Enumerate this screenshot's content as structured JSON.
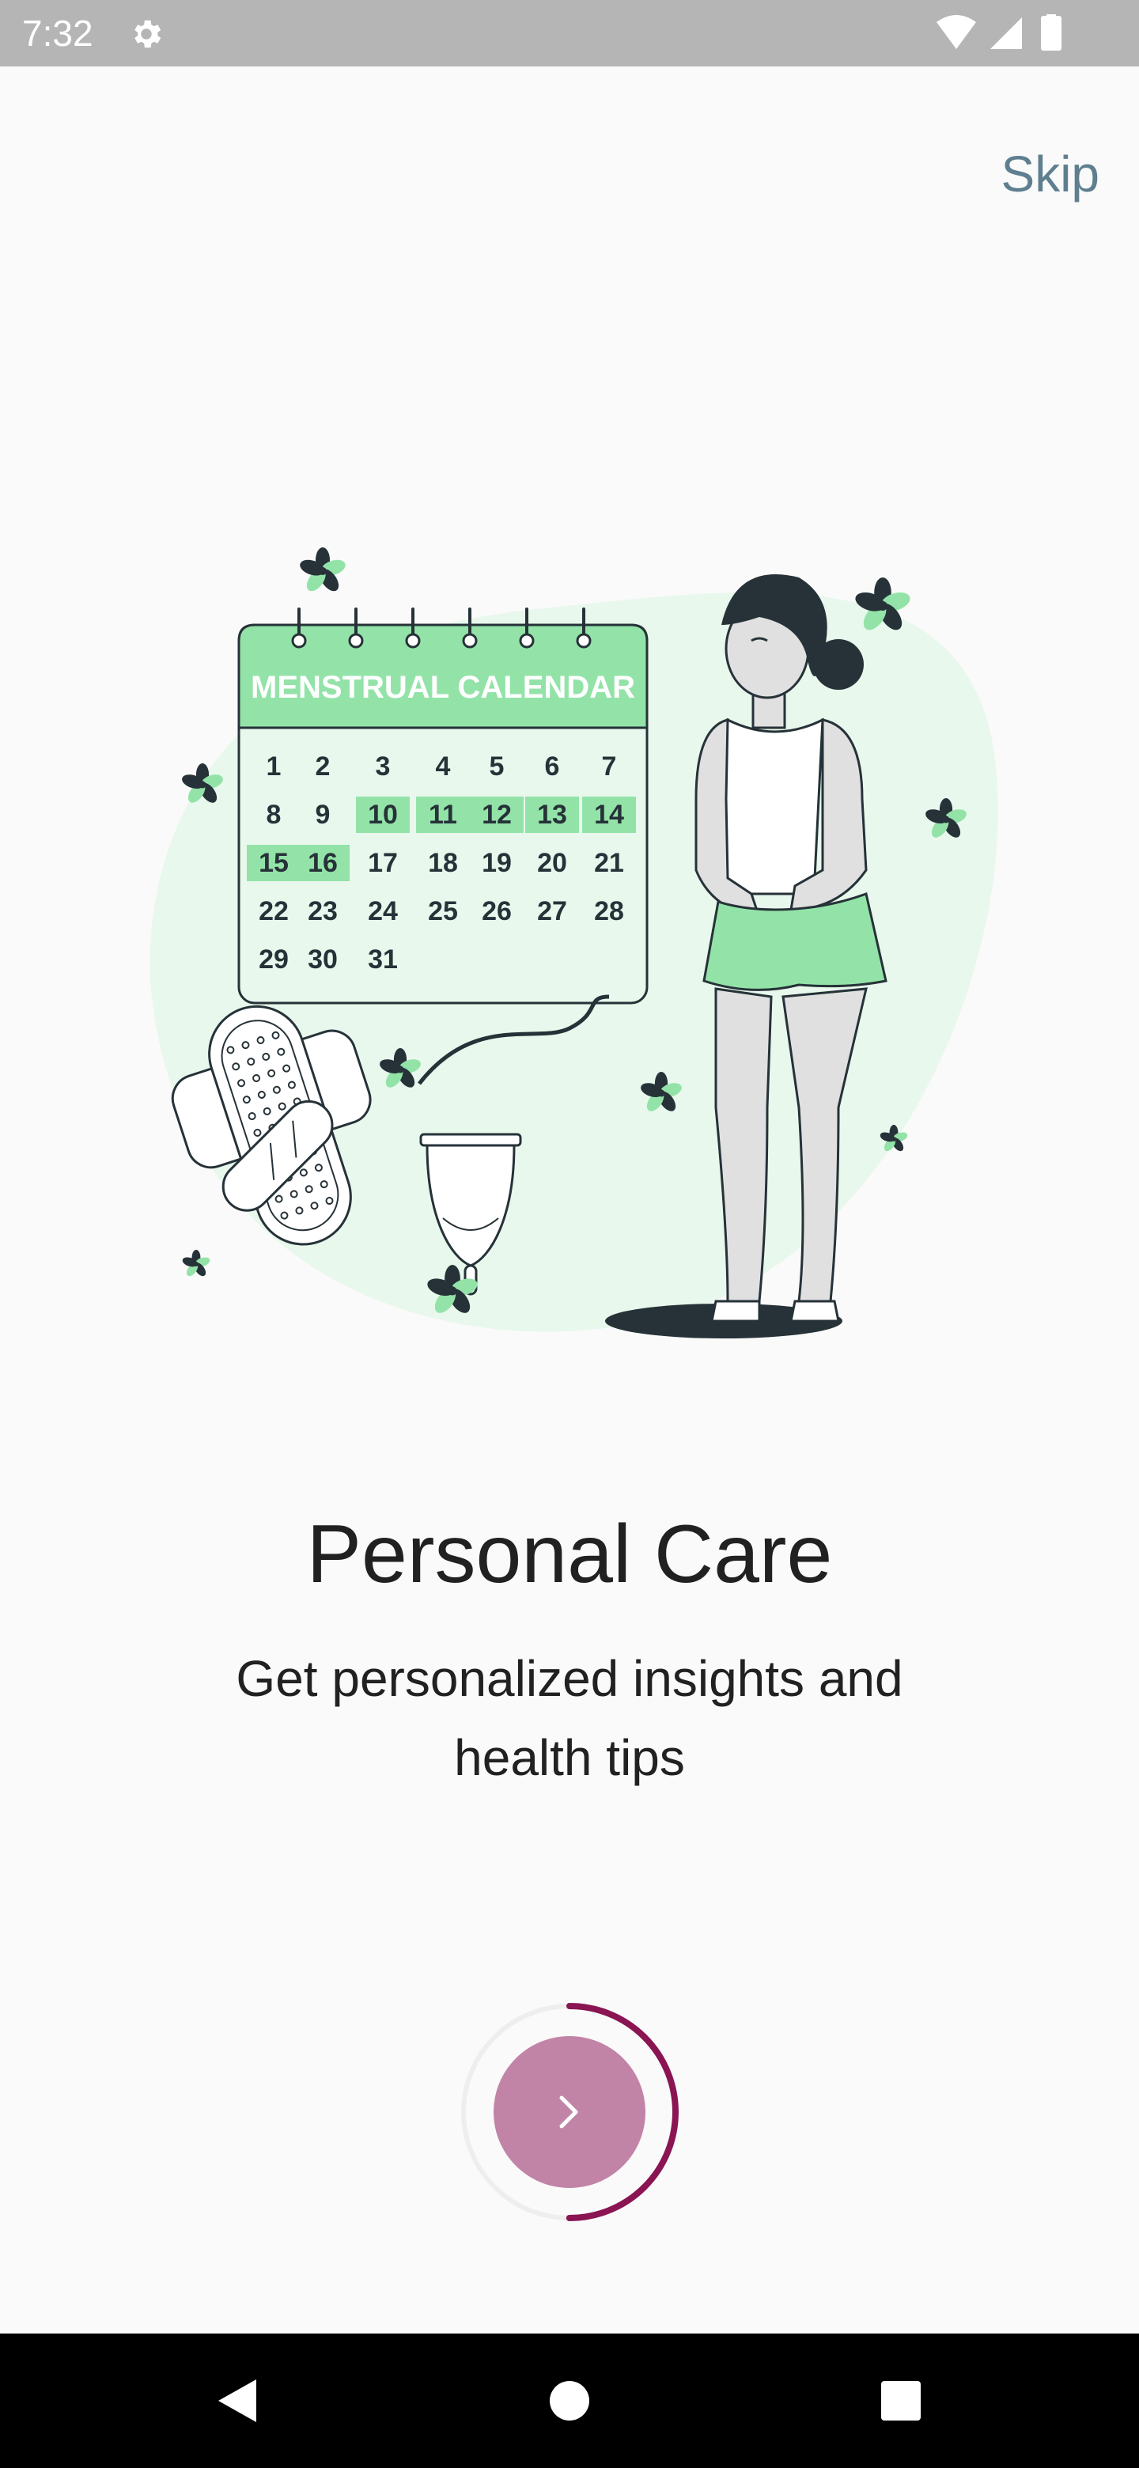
{
  "status_bar": {
    "time": "7:32",
    "left_icon": "gear-icon",
    "right_icons": [
      "wifi-icon",
      "signal-icon",
      "battery-icon"
    ]
  },
  "header": {
    "skip_label": "Skip"
  },
  "illustration": {
    "calendar_title": "MENSTRUAL CALENDAR",
    "calendar_days": [
      [
        "1",
        "2",
        "3",
        "4",
        "5",
        "6",
        "7"
      ],
      [
        "8",
        "9",
        "10",
        "11",
        "12",
        "13",
        "14"
      ],
      [
        "15",
        "16",
        "17",
        "18",
        "19",
        "20",
        "21"
      ],
      [
        "22",
        "23",
        "24",
        "25",
        "26",
        "27",
        "28"
      ],
      [
        "29",
        "30",
        "31",
        "",
        "",
        "",
        ""
      ]
    ],
    "highlighted_days": [
      "10",
      "11",
      "12",
      "13",
      "14",
      "15",
      "16"
    ],
    "colors": {
      "green": "#93e3a8",
      "light_green": "#e8f8ec",
      "dark": "#263238"
    }
  },
  "content": {
    "title": "Personal Care",
    "subtitle": "Get personalized insights and health tips"
  },
  "next_button": {
    "icon": "chevron-right-icon",
    "progress": 0.5,
    "colors": {
      "fill": "#c284a6",
      "ring": "#8a1552"
    }
  },
  "nav_bar": {
    "icons": [
      "back-icon",
      "home-icon",
      "recents-icon"
    ]
  }
}
